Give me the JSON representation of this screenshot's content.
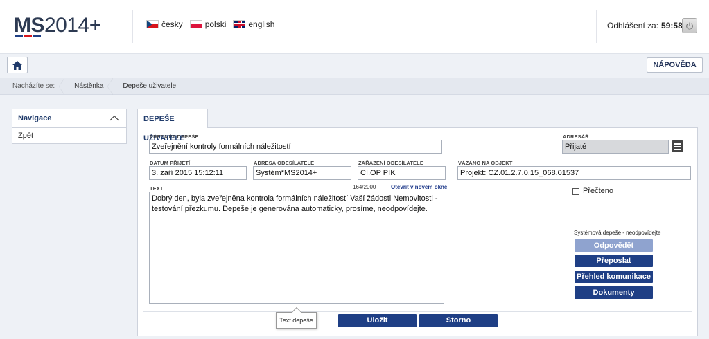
{
  "header": {
    "logo_bold": "MS",
    "logo_rest": "2014+",
    "languages": [
      {
        "label": "česky",
        "flag": "cz-flag-icon"
      },
      {
        "label": "polski",
        "flag": "pl-flag-icon"
      },
      {
        "label": "english",
        "flag": "uk-flag-icon"
      }
    ],
    "logout_label": "Odhlášení za:",
    "logout_timer": "59:58"
  },
  "toolbar": {
    "help_label": "NÁPOVĚDA"
  },
  "breadcrumb": {
    "prefix": "Nacházíte se:",
    "items": [
      "Nástěnka",
      "Depeše uživatele"
    ]
  },
  "nav": {
    "title": "Navigace",
    "items": [
      "Zpět"
    ]
  },
  "main": {
    "tab_label": "DEPEŠE UŽIVATELE",
    "subject_label": "PŘEDMĚT DEPEŠE",
    "subject_value": "Zveřejnění kontroly formálních náležitostí",
    "addressbook_label": "ADRESÁŘ",
    "addressbook_value": "Přijaté",
    "received_label": "DATUM PŘIJETÍ",
    "received_value": "3. září 2015 15:12:11",
    "sender_address_label": "ADRESA ODESÍLATELE",
    "sender_address_value": "Systém*MS2014+",
    "sender_assignment_label": "ZAŘAZENÍ ODESÍLATELE",
    "sender_assignment_value": "CI.OP PIK",
    "bound_object_label": "VÁZÁNO NA OBJEKT",
    "bound_object_value": "Projekt: CZ.01.2.7.0.15_068.01537",
    "text_label": "TEXT",
    "text_counter": "164/2000",
    "open_new_window": "Otevřít v novém okně",
    "text_value": "Dobrý den, byla zveřejněna kontrola formálních náležitostí Vaší žádosti Nemovitosti - testování přezkumu. Depeše je generována automaticky, prosíme, neodpovídejte.",
    "read_label": "Přečteno",
    "system_note": "Systémová depeše - neodpovídejte",
    "side_buttons": {
      "reply": "Odpovědět",
      "forward": "Přeposlat",
      "overview": "Přehled komunikace",
      "documents": "Dokumenty"
    },
    "tooltip": "Text depeše",
    "save_label": "Uložit",
    "cancel_label": "Storno"
  }
}
